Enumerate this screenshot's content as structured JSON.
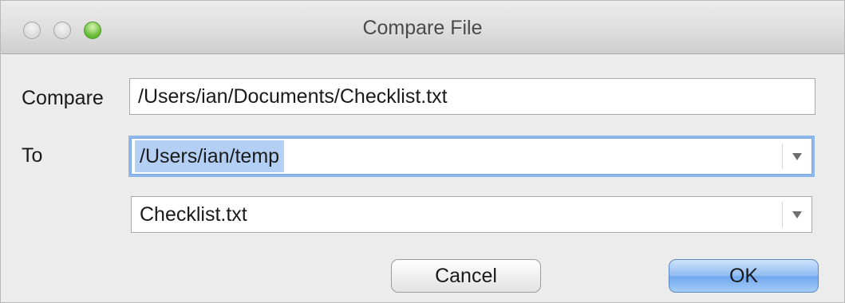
{
  "window": {
    "title": "Compare File"
  },
  "form": {
    "compare_label": "Compare",
    "compare_value": "/Users/ian/Documents/Checklist.txt",
    "to_label": "To",
    "to_directory_value": "/Users/ian/temp",
    "to_file_value": "Checklist.txt"
  },
  "buttons": {
    "cancel_label": "Cancel",
    "ok_label": "OK"
  },
  "icons": {
    "close": "close-icon",
    "minimize": "minimize-icon",
    "zoom": "zoom-icon",
    "dropdown": "chevron-down-icon"
  },
  "colors": {
    "focus_ring": "#8fb8ea",
    "selection": "#b3d0f4",
    "default_button": "#8fbcf2",
    "zoom_light": "#5fb82e"
  }
}
